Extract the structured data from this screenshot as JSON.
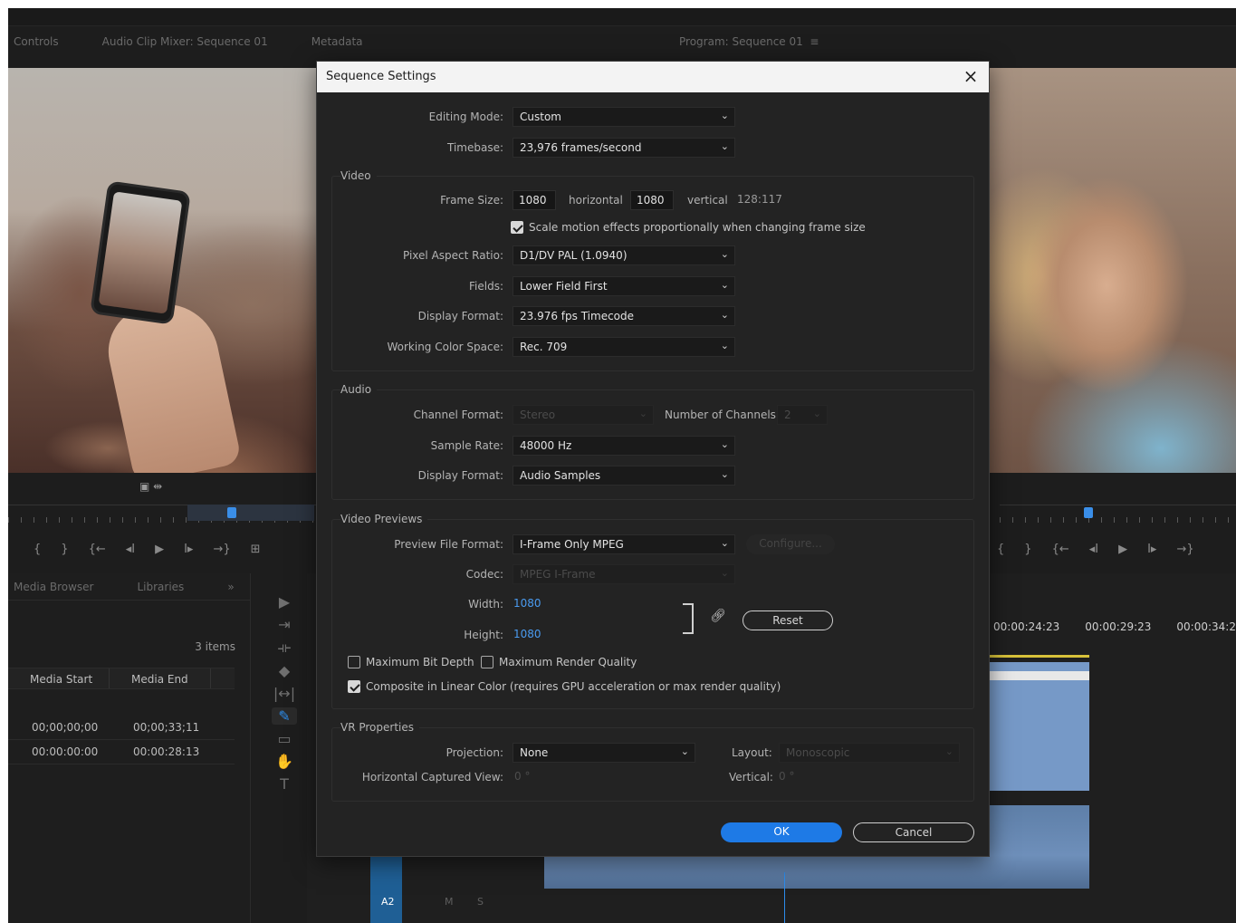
{
  "background_panels": {
    "tabs": [
      "Controls",
      "Audio Clip Mixer: Sequence 01",
      "Metadata"
    ],
    "program_tab": "Program: Sequence 01",
    "program_menu_icon": "hamburger-icon",
    "lower_tabs": [
      "Media Browser",
      "Libraries"
    ],
    "overflow": "»",
    "items_count": "3 items",
    "columns": [
      "Media Start",
      "Media End"
    ],
    "rows": [
      [
        "00;00;00;00",
        "00;00;33;11"
      ],
      [
        "00:00:00:00",
        "00:00:28:13"
      ]
    ],
    "timecodes": [
      "00:00:24:23",
      "00:00:29:23",
      "00:00:34:2"
    ],
    "track_label": "A2",
    "track_buttons": [
      "M",
      "S"
    ]
  },
  "dialog": {
    "title": "Sequence Settings",
    "close": "×",
    "editing_mode": {
      "label": "Editing Mode:",
      "value": "Custom"
    },
    "timebase": {
      "label": "Timebase:",
      "value": "23,976  frames/second"
    },
    "video": {
      "title": "Video",
      "frame_size_label": "Frame Size:",
      "width": "1080",
      "horizontal": "horizontal",
      "height": "1080",
      "vertical": "vertical",
      "ratio": "128:117",
      "scale_motion": "Scale motion effects proportionally when changing frame size",
      "pixel_aspect_label": "Pixel Aspect Ratio:",
      "pixel_aspect_value": "D1/DV PAL (1.0940)",
      "fields_label": "Fields:",
      "fields_value": "Lower Field First",
      "display_format_label": "Display Format:",
      "display_format_value": "23.976 fps Timecode",
      "color_space_label": "Working Color Space:",
      "color_space_value": "Rec. 709"
    },
    "audio": {
      "title": "Audio",
      "channel_format_label": "Channel Format:",
      "channel_format_value": "Stereo",
      "channels_label": "Number of Channels:",
      "channels_value": "2",
      "sample_rate_label": "Sample Rate:",
      "sample_rate_value": "48000 Hz",
      "display_format_label": "Display Format:",
      "display_format_value": "Audio Samples"
    },
    "previews": {
      "title": "Video Previews",
      "file_format_label": "Preview File Format:",
      "file_format_value": "I-Frame Only MPEG",
      "configure": "Configure...",
      "codec_label": "Codec:",
      "codec_value": "MPEG I-Frame",
      "width_label": "Width:",
      "width_value": "1080",
      "height_label": "Height:",
      "height_value": "1080",
      "reset": "Reset",
      "max_bit_depth": "Maximum Bit Depth",
      "max_render_quality": "Maximum Render Quality",
      "composite_linear": "Composite in Linear Color (requires GPU acceleration or max render quality)"
    },
    "vr": {
      "title": "VR Properties",
      "projection_label": "Projection:",
      "projection_value": "None",
      "layout_label": "Layout:",
      "layout_value": "Monoscopic",
      "hcv_label": "Horizontal Captured View:",
      "hcv_value": "0 °",
      "vertical_label": "Vertical:",
      "vertical_value": "0 °"
    },
    "ok": "OK",
    "cancel": "Cancel"
  },
  "colors": {
    "accent": "#1e7ae6",
    "link": "#4a9bf0",
    "dialog_bg": "#232323",
    "title_bar": "#f3f3f3"
  }
}
